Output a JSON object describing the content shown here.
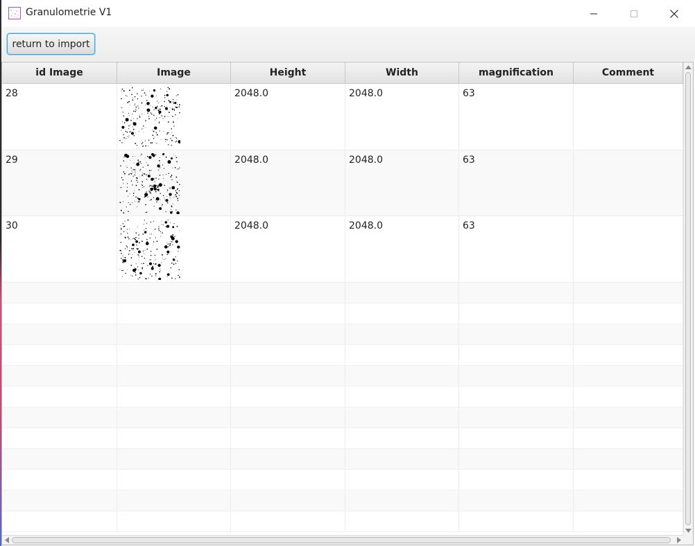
{
  "window": {
    "title": "Granulometrie V1",
    "controls": [
      "minimize-icon",
      "maximize-icon",
      "close-icon"
    ]
  },
  "toolbar": {
    "return_label": "return to import"
  },
  "table": {
    "columns": [
      "id Image",
      "Image",
      "Height",
      "Width",
      "magnification",
      "Comment"
    ],
    "rows": [
      {
        "id": "28",
        "image": "particle-thumbnail",
        "height": "2048.0",
        "width": "2048.0",
        "magnification": "63",
        "comment": ""
      },
      {
        "id": "29",
        "image": "particle-thumbnail",
        "height": "2048.0",
        "width": "2048.0",
        "magnification": "63",
        "comment": ""
      },
      {
        "id": "30",
        "image": "particle-thumbnail",
        "height": "2048.0",
        "width": "2048.0",
        "magnification": "63",
        "comment": ""
      }
    ],
    "empty_rows": 12
  },
  "colors": {
    "focus_border": "#3aa6dd",
    "app_icon": "#b14fc8"
  }
}
